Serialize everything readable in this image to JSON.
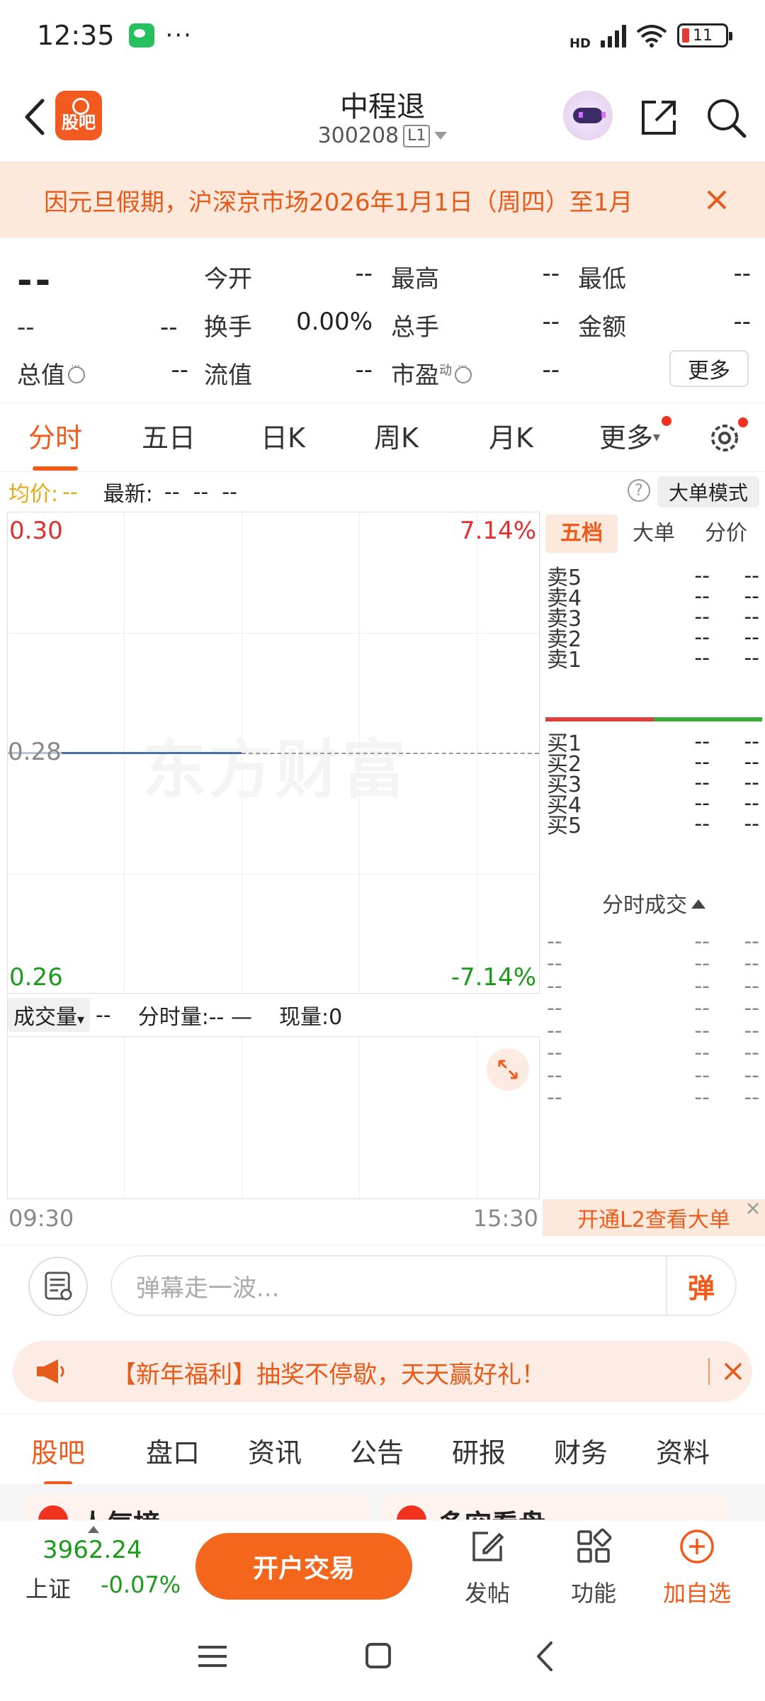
{
  "status_bar": {
    "time": "12:35",
    "dots": "···",
    "battery": "11",
    "network": "HD"
  },
  "header": {
    "title": "中程退",
    "code": "300208",
    "level": "L1",
    "logo_text": "股吧"
  },
  "notice": {
    "text": "因元旦假期，沪深京市场2026年1月1日（周四）至1月"
  },
  "quote": {
    "price": "--",
    "change": "--",
    "change_pct": "--",
    "rows": [
      {
        "label": "今开",
        "value": "--"
      },
      {
        "label": "最高",
        "value": "--"
      },
      {
        "label": "最低",
        "value": "--"
      },
      {
        "label": "换手",
        "value": "0.00%"
      },
      {
        "label": "总手",
        "value": "--"
      },
      {
        "label": "金额",
        "value": "--"
      },
      {
        "label": "总值",
        "value": "--"
      },
      {
        "label": "流值",
        "value": "--"
      },
      {
        "label": "市盈",
        "value": "--"
      }
    ],
    "pe_sup": "动",
    "more": "更多"
  },
  "tabs": [
    {
      "label": "分时"
    },
    {
      "label": "五日"
    },
    {
      "label": "日K"
    },
    {
      "label": "周K"
    },
    {
      "label": "月K"
    },
    {
      "label": "更多"
    }
  ],
  "chart_info": {
    "avg_label": "均价:",
    "avg_value": "--",
    "latest_label": "最新:",
    "latest_values": "--  --  --",
    "help": "?",
    "big_order_btn": "大单模式"
  },
  "chart": {
    "watermark": "东方财富",
    "y_top": "0.30",
    "y_mid": "0.28",
    "y_bot": "0.26",
    "pct_top": "7.14%",
    "pct_bot": "-7.14%",
    "x_start": "09:30",
    "x_end": "15:30"
  },
  "volume": {
    "select_label": "成交量",
    "select_value": "--",
    "minute_vol": "分时量:-- —",
    "now_vol": "现量:0"
  },
  "orderbook": {
    "tabs": [
      {
        "label": "五档"
      },
      {
        "label": "大单"
      },
      {
        "label": "分价"
      }
    ],
    "sells": [
      {
        "label": "卖5",
        "price": "--",
        "vol": "--"
      },
      {
        "label": "卖4",
        "price": "--",
        "vol": "--"
      },
      {
        "label": "卖3",
        "price": "--",
        "vol": "--"
      },
      {
        "label": "卖2",
        "price": "--",
        "vol": "--"
      },
      {
        "label": "卖1",
        "price": "--",
        "vol": "--"
      }
    ],
    "buys": [
      {
        "label": "买1",
        "price": "--",
        "vol": "--"
      },
      {
        "label": "买2",
        "price": "--",
        "vol": "--"
      },
      {
        "label": "买3",
        "price": "--",
        "vol": "--"
      },
      {
        "label": "买4",
        "price": "--",
        "vol": "--"
      },
      {
        "label": "买5",
        "price": "--",
        "vol": "--"
      }
    ],
    "trades_title": "分时成交",
    "trades": [
      {
        "t": "--",
        "p": "--",
        "v": "--"
      },
      {
        "t": "--",
        "p": "--",
        "v": "--"
      },
      {
        "t": "--",
        "p": "--",
        "v": "--"
      },
      {
        "t": "--",
        "p": "--",
        "v": "--"
      },
      {
        "t": "--",
        "p": "--",
        "v": "--"
      },
      {
        "t": "--",
        "p": "--",
        "v": "--"
      },
      {
        "t": "--",
        "p": "--",
        "v": "--"
      },
      {
        "t": "--",
        "p": "--",
        "v": "--"
      }
    ],
    "l2_banner": "开通L2查看大单"
  },
  "comment": {
    "placeholder": "弹幕走一波...",
    "danmu_label": "弹"
  },
  "promo": {
    "text": "【新年福利】抽奖不停歇，天天赢好礼！"
  },
  "lower_tabs": [
    {
      "label": "股吧"
    },
    {
      "label": "盘口"
    },
    {
      "label": "资讯"
    },
    {
      "label": "公告"
    },
    {
      "label": "研报"
    },
    {
      "label": "财务"
    },
    {
      "label": "资料"
    }
  ],
  "cards_peek": [
    {
      "title": "人气榜"
    },
    {
      "title": "多空看盘"
    }
  ],
  "bottom_bar": {
    "index_value": "3962.24",
    "index_name": "上证",
    "index_change": "-0.07%",
    "trade_btn": "开户交易",
    "post": "发帖",
    "functions": "功能",
    "add_watch": "加自选"
  },
  "colors": {
    "accent": "#f05a1a",
    "up": "#e03030",
    "down": "#1b9b1b",
    "avg": "#e6a817",
    "line": "#4a6fa5"
  }
}
